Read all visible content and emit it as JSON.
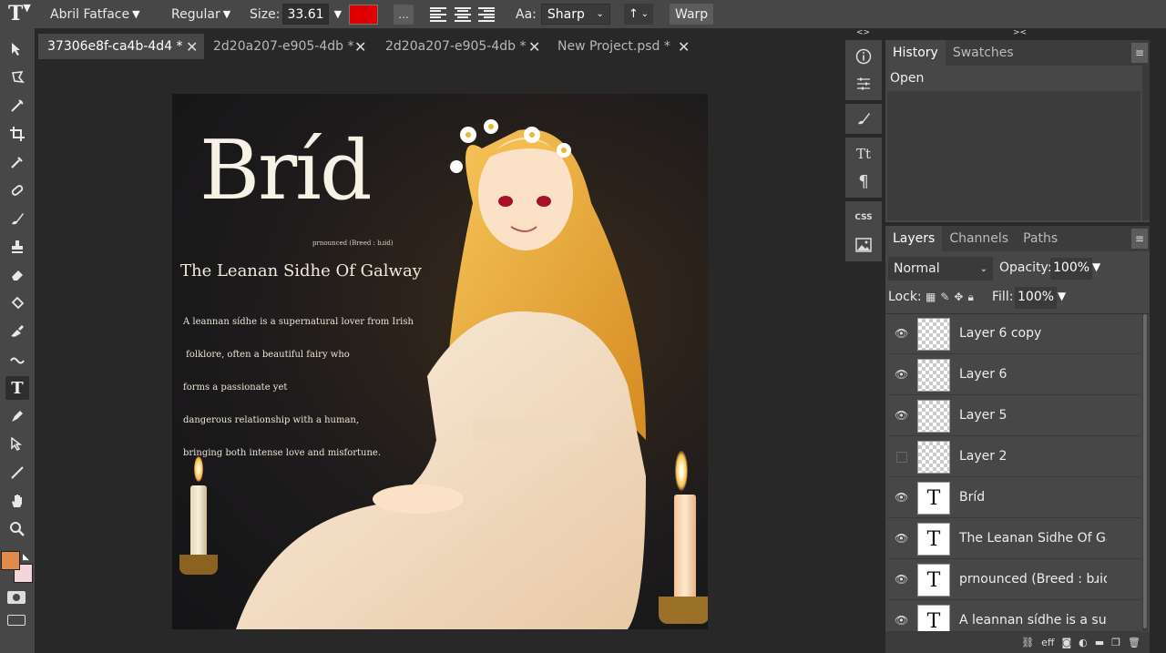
{
  "toolbar_top": {
    "font_family": "Abril Fatface",
    "font_style": "Regular",
    "size_label": "Size:",
    "size_value": "33.61",
    "text_color": "#e00000",
    "more": "...",
    "aa_label": "Aa:",
    "aa_value": "Sharp",
    "orientation": "↑",
    "warp_label": "Warp"
  },
  "tabs": [
    {
      "label": "37306e8f-ca4b-4d4 *",
      "active": true
    },
    {
      "label": "2d20a207-e905-4db *",
      "active": false
    },
    {
      "label": "2d20a207-e905-4db *",
      "active": false
    },
    {
      "label": "New Project.psd *",
      "active": false
    }
  ],
  "artwork": {
    "title": "Bríd",
    "pronounce": "prnounced (Breed : bɹid)",
    "subtitle": "The Leanan Sidhe Of Galway",
    "body_lines": [
      "A leannan sídhe is a supernatural lover from Irish",
      " folklore, often a beautiful fairy who",
      "forms a passionate yet",
      "dangerous relationship with a human,",
      "bringing both intense love and misfortune."
    ]
  },
  "colors": {
    "foreground": "#e08a4c",
    "background": "#f5d5dc"
  },
  "history_panel": {
    "tabs": [
      "History",
      "Swatches"
    ],
    "items": [
      "Open"
    ]
  },
  "layers_panel": {
    "tabs": [
      "Layers",
      "Channels",
      "Paths"
    ],
    "blend_mode": "Normal",
    "opacity_label": "Opacity:",
    "opacity_value": "100%",
    "lock_label": "Lock:",
    "fill_label": "Fill:",
    "fill_value": "100%",
    "layers": [
      {
        "name": "Layer 6 copy",
        "type": "raster",
        "visible": true
      },
      {
        "name": "Layer 6",
        "type": "raster",
        "visible": true
      },
      {
        "name": "Layer 5",
        "type": "raster",
        "visible": true
      },
      {
        "name": "Layer 2",
        "type": "raster",
        "visible": false
      },
      {
        "name": "Bríd",
        "type": "text",
        "visible": true
      },
      {
        "name": "The Leanan Sidhe Of Galway",
        "type": "text",
        "visible": true
      },
      {
        "name": "prnounced (Breed : bɹid)",
        "type": "text",
        "visible": true
      },
      {
        "name": "A leannan sídhe is a supernatural",
        "type": "text",
        "visible": true
      }
    ],
    "footer_icons": [
      "link-icon",
      "effects-icon",
      "mask-icon",
      "adjustment-icon",
      "folder-icon",
      "new-layer-icon",
      "trash-icon"
    ]
  },
  "collapse_labels": {
    "left": "<>",
    "right": "><"
  },
  "side_icons": [
    "info-icon",
    "adjustments-icon",
    "brush-settings-icon",
    "character-icon",
    "paragraph-icon",
    "css-icon",
    "image-icon"
  ],
  "tools": [
    "move-tool-icon",
    "lasso-tool-icon",
    "quick-select-icon",
    "crop-icon",
    "eyedropper-icon",
    "healing-icon",
    "brush-icon",
    "stamp-icon",
    "eraser-icon",
    "fill-icon",
    "smudge-icon",
    "sharpen-icon",
    "type-tool-icon",
    "pen-icon",
    "path-select-icon",
    "line-icon",
    "hand-icon",
    "zoom-icon"
  ]
}
